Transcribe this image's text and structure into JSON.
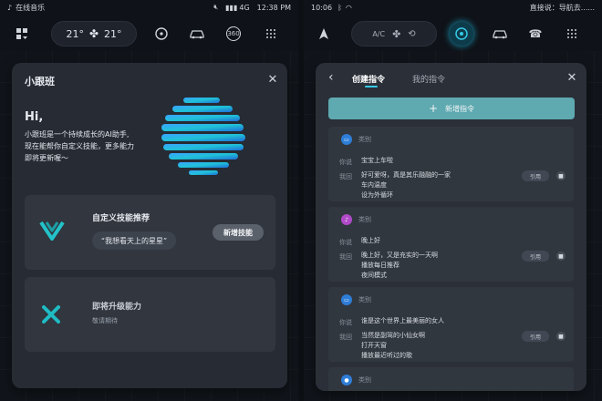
{
  "left": {
    "status": {
      "app": "在线音乐",
      "network": "4G",
      "time": "12:38 PM"
    },
    "climate": {
      "left_temp": "21°",
      "right_temp": "21°"
    },
    "topbar_icons": [
      "grid-icon",
      "fan-icon",
      "steering-icon",
      "car-icon",
      "360-icon",
      "apps-icon"
    ],
    "camera_label": "360",
    "dialog": {
      "title": "小跟班",
      "greeting": "Hi,",
      "intro": [
        "小跟班是一个持续成长的AI助手,",
        "现在能帮你自定义技能，更多能力",
        "即将更新喔～"
      ],
      "skill": {
        "title": "自定义技能推荐",
        "example": "“我想看天上的星星”",
        "button": "新增技能"
      },
      "upgrade": {
        "title": "即将升级能力",
        "subtitle": "敬请期待"
      }
    }
  },
  "right": {
    "status": {
      "time": "10:06",
      "nav": "直接说：导航去......"
    },
    "climate": {
      "ac": "A/C"
    },
    "tabs": [
      "创建指令",
      "我的指令"
    ],
    "add_button": "新增指令",
    "commands": [
      {
        "category": "类别",
        "icon_color": "#2e7dd7",
        "icon": "car-icon",
        "phrase_label": "你说",
        "phrase": "宝宝上车啦",
        "reply_label": "我回",
        "replies": [
          "好可爱呀，真是其乐融融的一家",
          "车内温度",
          "设为外循环"
        ],
        "use": "引用"
      },
      {
        "category": "类别",
        "icon_color": "#b04ac7",
        "icon": "music-icon",
        "phrase_label": "你说",
        "phrase": "晚上好",
        "reply_label": "我回",
        "replies": [
          "晚上好，又是充实的一天啊",
          "播放每日推荐",
          "夜间模式"
        ],
        "use": "引用"
      },
      {
        "category": "类别",
        "icon_color": "#2e7dd7",
        "icon": "car-icon",
        "phrase_label": "你说",
        "phrase": "谁是这个世界上最美丽的女人",
        "reply_label": "我回",
        "replies": [
          "当然是副驾的小仙女啊",
          "打开天窗",
          "播放最近听过的歌"
        ],
        "use": "引用"
      },
      {
        "category": "类别",
        "icon_color": "#2e7dd7",
        "icon": "mic-icon"
      }
    ]
  }
}
